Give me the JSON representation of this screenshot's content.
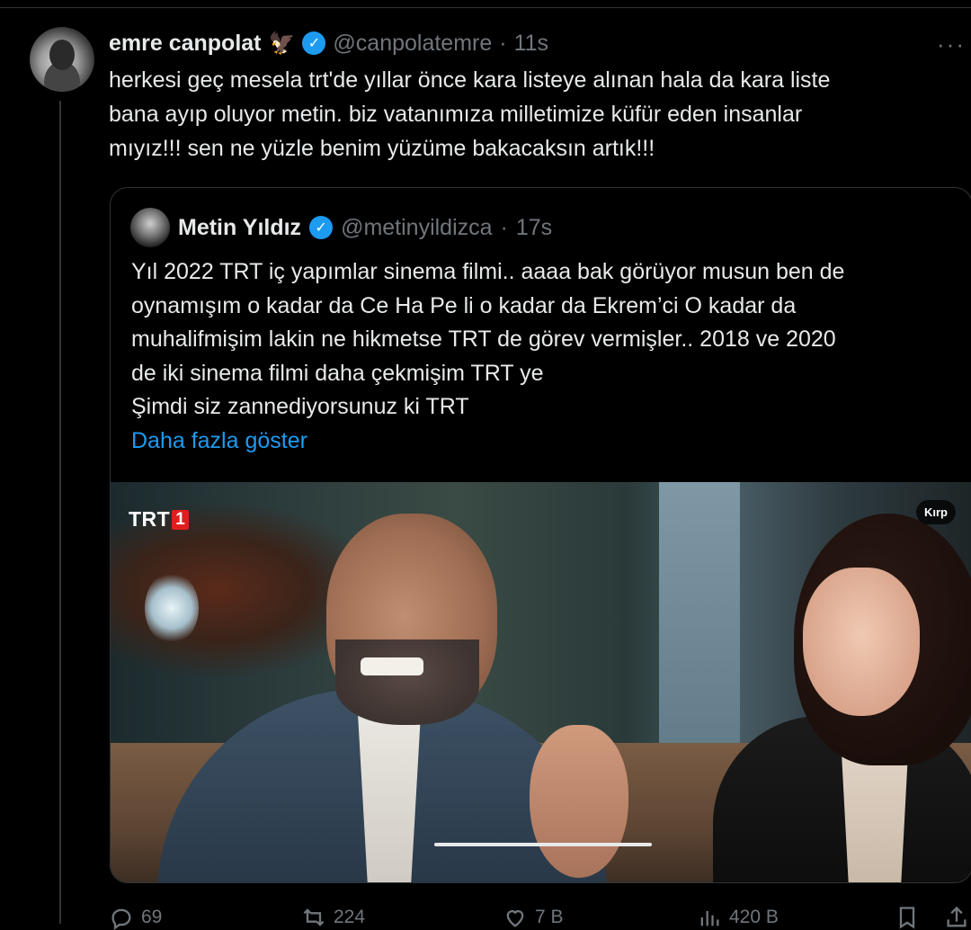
{
  "tweet": {
    "author_name": "emre canpolat",
    "author_emoji": "🦅",
    "author_handle": "@canpolatemre",
    "separator": "·",
    "time": "11s",
    "more": "···",
    "text_lines": [
      "herkesi geç mesela trt'de yıllar önce kara listeye alınan hala da kara liste",
      "bana ayıp oluyor metin. biz vatanımıza milletimize küfür eden insanlar",
      "mıyız!!!  sen ne yüzle benim yüzüme bakacaksın artık!!!"
    ]
  },
  "quote": {
    "author_name": "Metin Yıldız",
    "author_handle": "@metinyildizca",
    "separator": "·",
    "time": "17s",
    "text_lines": [
      "Yıl 2022 TRT iç yapımlar sinema filmi.. aaaa bak görüyor musun ben de",
      "oynamışım o kadar da Ce Ha Pe li o kadar da Ekrem’ci O kadar da",
      "muhalifmişim lakin ne hikmetse TRT de görev vermişler.. 2018 ve 2020",
      "de iki sinema filmi daha çekmişim TRT ye",
      "Şimdi siz zannediyorsunuz ki TRT"
    ],
    "show_more": "Daha fazla göster",
    "media": {
      "logo_text": "TRT",
      "logo_number": "1",
      "crop_label": "Kırp"
    }
  },
  "actions": {
    "replies": "69",
    "reposts": "224",
    "likes": "7 B",
    "views": "420 B"
  },
  "colors": {
    "background": "#000000",
    "text": "#e7e9ea",
    "muted": "#71767b",
    "link": "#1d9bf0",
    "border": "#2f3336"
  }
}
